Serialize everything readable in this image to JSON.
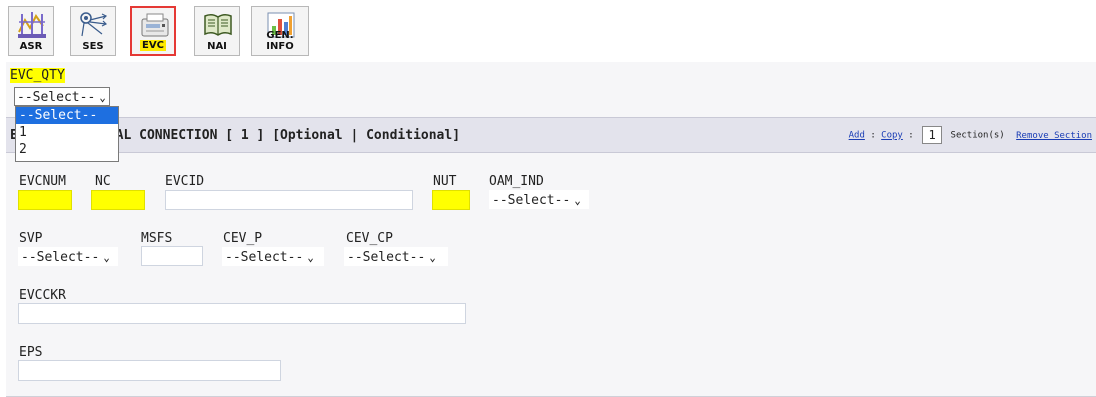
{
  "toolbar": {
    "tabs": [
      {
        "label": "ASR",
        "icon": "asr-chart-icon"
      },
      {
        "label": "SES",
        "icon": "network-icon"
      },
      {
        "label": "EVC",
        "icon": "fax-machine-icon",
        "active": true
      },
      {
        "label": "NAI",
        "icon": "book-icon"
      },
      {
        "label": "GEN. INFO",
        "icon": "bar-chart-icon"
      }
    ]
  },
  "evc_qty": {
    "label": "EVC_QTY",
    "value": "--Select--",
    "options": [
      "--Select--",
      "1",
      "2"
    ]
  },
  "section": {
    "title_prefix": "E",
    "title": "UAL CONNECTION [ 1 ] [Optional | Conditional]",
    "add_label": "Add",
    "copy_label": "Copy",
    "sep": ":",
    "count": "1",
    "sections_label": "Section(s)",
    "remove_label": "Remove Section"
  },
  "fields": {
    "evcnum": {
      "label": "EVCNUM"
    },
    "nc": {
      "label": "NC"
    },
    "evcid": {
      "label": "EVCID"
    },
    "nut": {
      "label": "NUT"
    },
    "oam_ind": {
      "label": "OAM_IND",
      "value": "--Select--"
    },
    "svp": {
      "label": "SVP",
      "value": "--Select--"
    },
    "msfs": {
      "label": "MSFS"
    },
    "cev_p": {
      "label": "CEV_P",
      "value": "--Select--"
    },
    "cev_cp": {
      "label": "CEV_CP",
      "value": "--Select--"
    },
    "evcckr": {
      "label": "EVCCKR"
    },
    "eps": {
      "label": "EPS"
    }
  },
  "colors": {
    "highlight": "#ffff00",
    "active_border": "#e53935",
    "option_selected": "#1e6fe0",
    "link": "#1a3db5"
  }
}
